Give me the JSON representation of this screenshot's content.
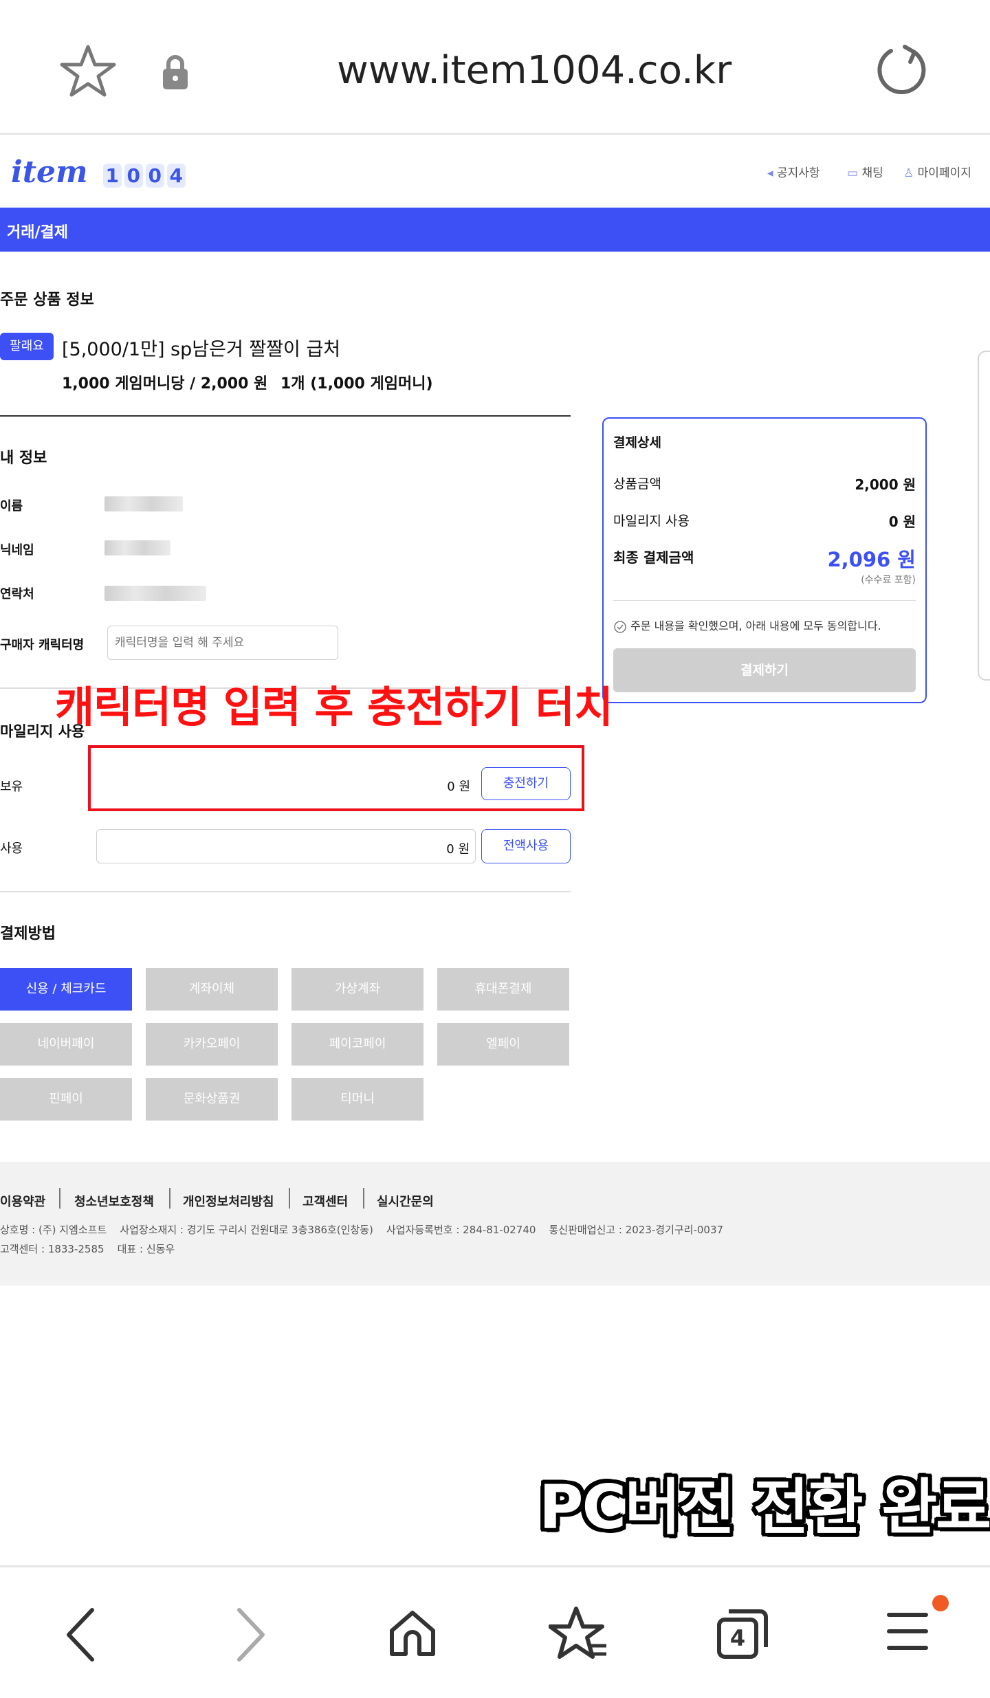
{
  "browser": {
    "url": "www.item1004.co.kr",
    "icons": [
      "star-icon",
      "lock-icon",
      "reload-icon"
    ]
  },
  "site": {
    "logo_text": "item",
    "logo_digits": [
      "1",
      "0",
      "0",
      "4"
    ],
    "header_links": [
      "공지사항",
      "채팅",
      "마이페이지"
    ],
    "section_bar_title": "거래/결제",
    "accent_color": "#3d50f5"
  },
  "order_info": {
    "heading": "주문 상품 정보",
    "badge": "팔래요",
    "title": "[5,000/1만] sp남은거 짤짤이 급처",
    "price_line": "1,000 게임머니당 / 2,000 원",
    "qty_line": "1개 (1,000 게임머니)"
  },
  "my_info": {
    "heading": "내 정보",
    "name_label": "이름",
    "nickname_label": "닉네임",
    "contact_label": "연락처",
    "character_label": "구매자 캐릭터명",
    "character_placeholder": "캐릭터명을 입력 해 주세요"
  },
  "mileage": {
    "heading": "마일리지 사용",
    "owned_label": "보유",
    "owned_value": "0 원",
    "charge_button": "충전하기",
    "use_label": "사용",
    "use_value": "0 원",
    "use_all_button": "전액사용"
  },
  "payment_methods": {
    "heading": "결제방법",
    "options": [
      "신용 / 체크카드",
      "계좌이체",
      "가상계좌",
      "휴대폰결제",
      "네이버페이",
      "카카오페이",
      "페이코페이",
      "엘페이",
      "핀페이",
      "문화상품권",
      "티머니"
    ],
    "selected": "신용 / 체크카드"
  },
  "summary": {
    "heading": "결제상세",
    "product_label": "상품금액",
    "product_value": "2,000 원",
    "mileage_label": "마일리지 사용",
    "mileage_value": "0 원",
    "final_label": "최종 결제금액",
    "final_value": "2,096 원",
    "fee_note": "(수수료 포함)",
    "agree_text": "주문 내용을 확인했으며, 아래 내용에 모두 동의합니다.",
    "pay_button": "결제하기"
  },
  "footer": {
    "links": [
      "이용약관",
      "청소년보호정책",
      "개인정보처리방침",
      "고객센터",
      "실시간문의"
    ],
    "info_line1": "상호명 : (주) 지엠소프트    사업장소재지 : 경기도 구리시 건원대로 3층386호(인창동)    사업자등록번호 : 284-81-02740    통신판매업신고 : 2023-경기구리-0037",
    "info_line2": "고객센터 : 1833-2585    대표 : 신동우"
  },
  "annotations": {
    "instruction": "캐릭터명 입력 후 충전하기 터치",
    "status": "PC버전 전환 완료"
  },
  "bottom_nav": {
    "tab_count": "4",
    "icons": [
      "back-icon",
      "forward-icon",
      "home-icon",
      "bookmarks-icon",
      "tabs-icon",
      "menu-icon"
    ]
  }
}
